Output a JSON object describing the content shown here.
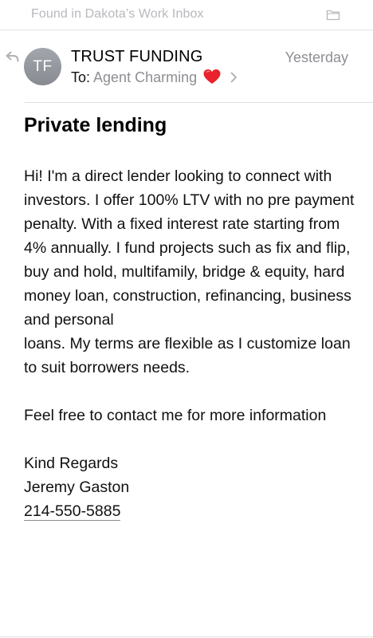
{
  "header": {
    "mailbox_label": "Found in Dakota’s Work Inbox",
    "folder_icon": "folder-icon",
    "reply_icon": "reply-arrow-icon"
  },
  "message": {
    "avatar_initials": "TF",
    "sender": "TRUST FUNDING",
    "date": "Yesterday",
    "to_prefix": "To:",
    "recipient": "Agent Charming",
    "recipient_icon": "red-heart-emoji",
    "subject": "Private lending",
    "body": {
      "paragraph_1_line_1": "Hi! I'm a direct lender looking to connect with investors. I offer 100% LTV with no pre payment penalty. With a fixed interest rate starting from 4% annually. I fund projects such as fix and flip, buy and hold, multifamily, bridge & equity, hard money loan, construction, refinancing, business and personal",
      "paragraph_1_line_2": "loans. My terms are flexible as I customize loan to suit borrowers needs.",
      "paragraph_2": "Feel free to contact me for more information",
      "closing": "Kind Regards",
      "signature_name": "Jeremy Gaston",
      "phone": "214-550-5885"
    }
  },
  "colors": {
    "secondary_text": "#8e8e93",
    "mailbox_label": "#b8b8bd",
    "avatar_bg": "#9a9ca3",
    "heart": "#e8232b"
  }
}
